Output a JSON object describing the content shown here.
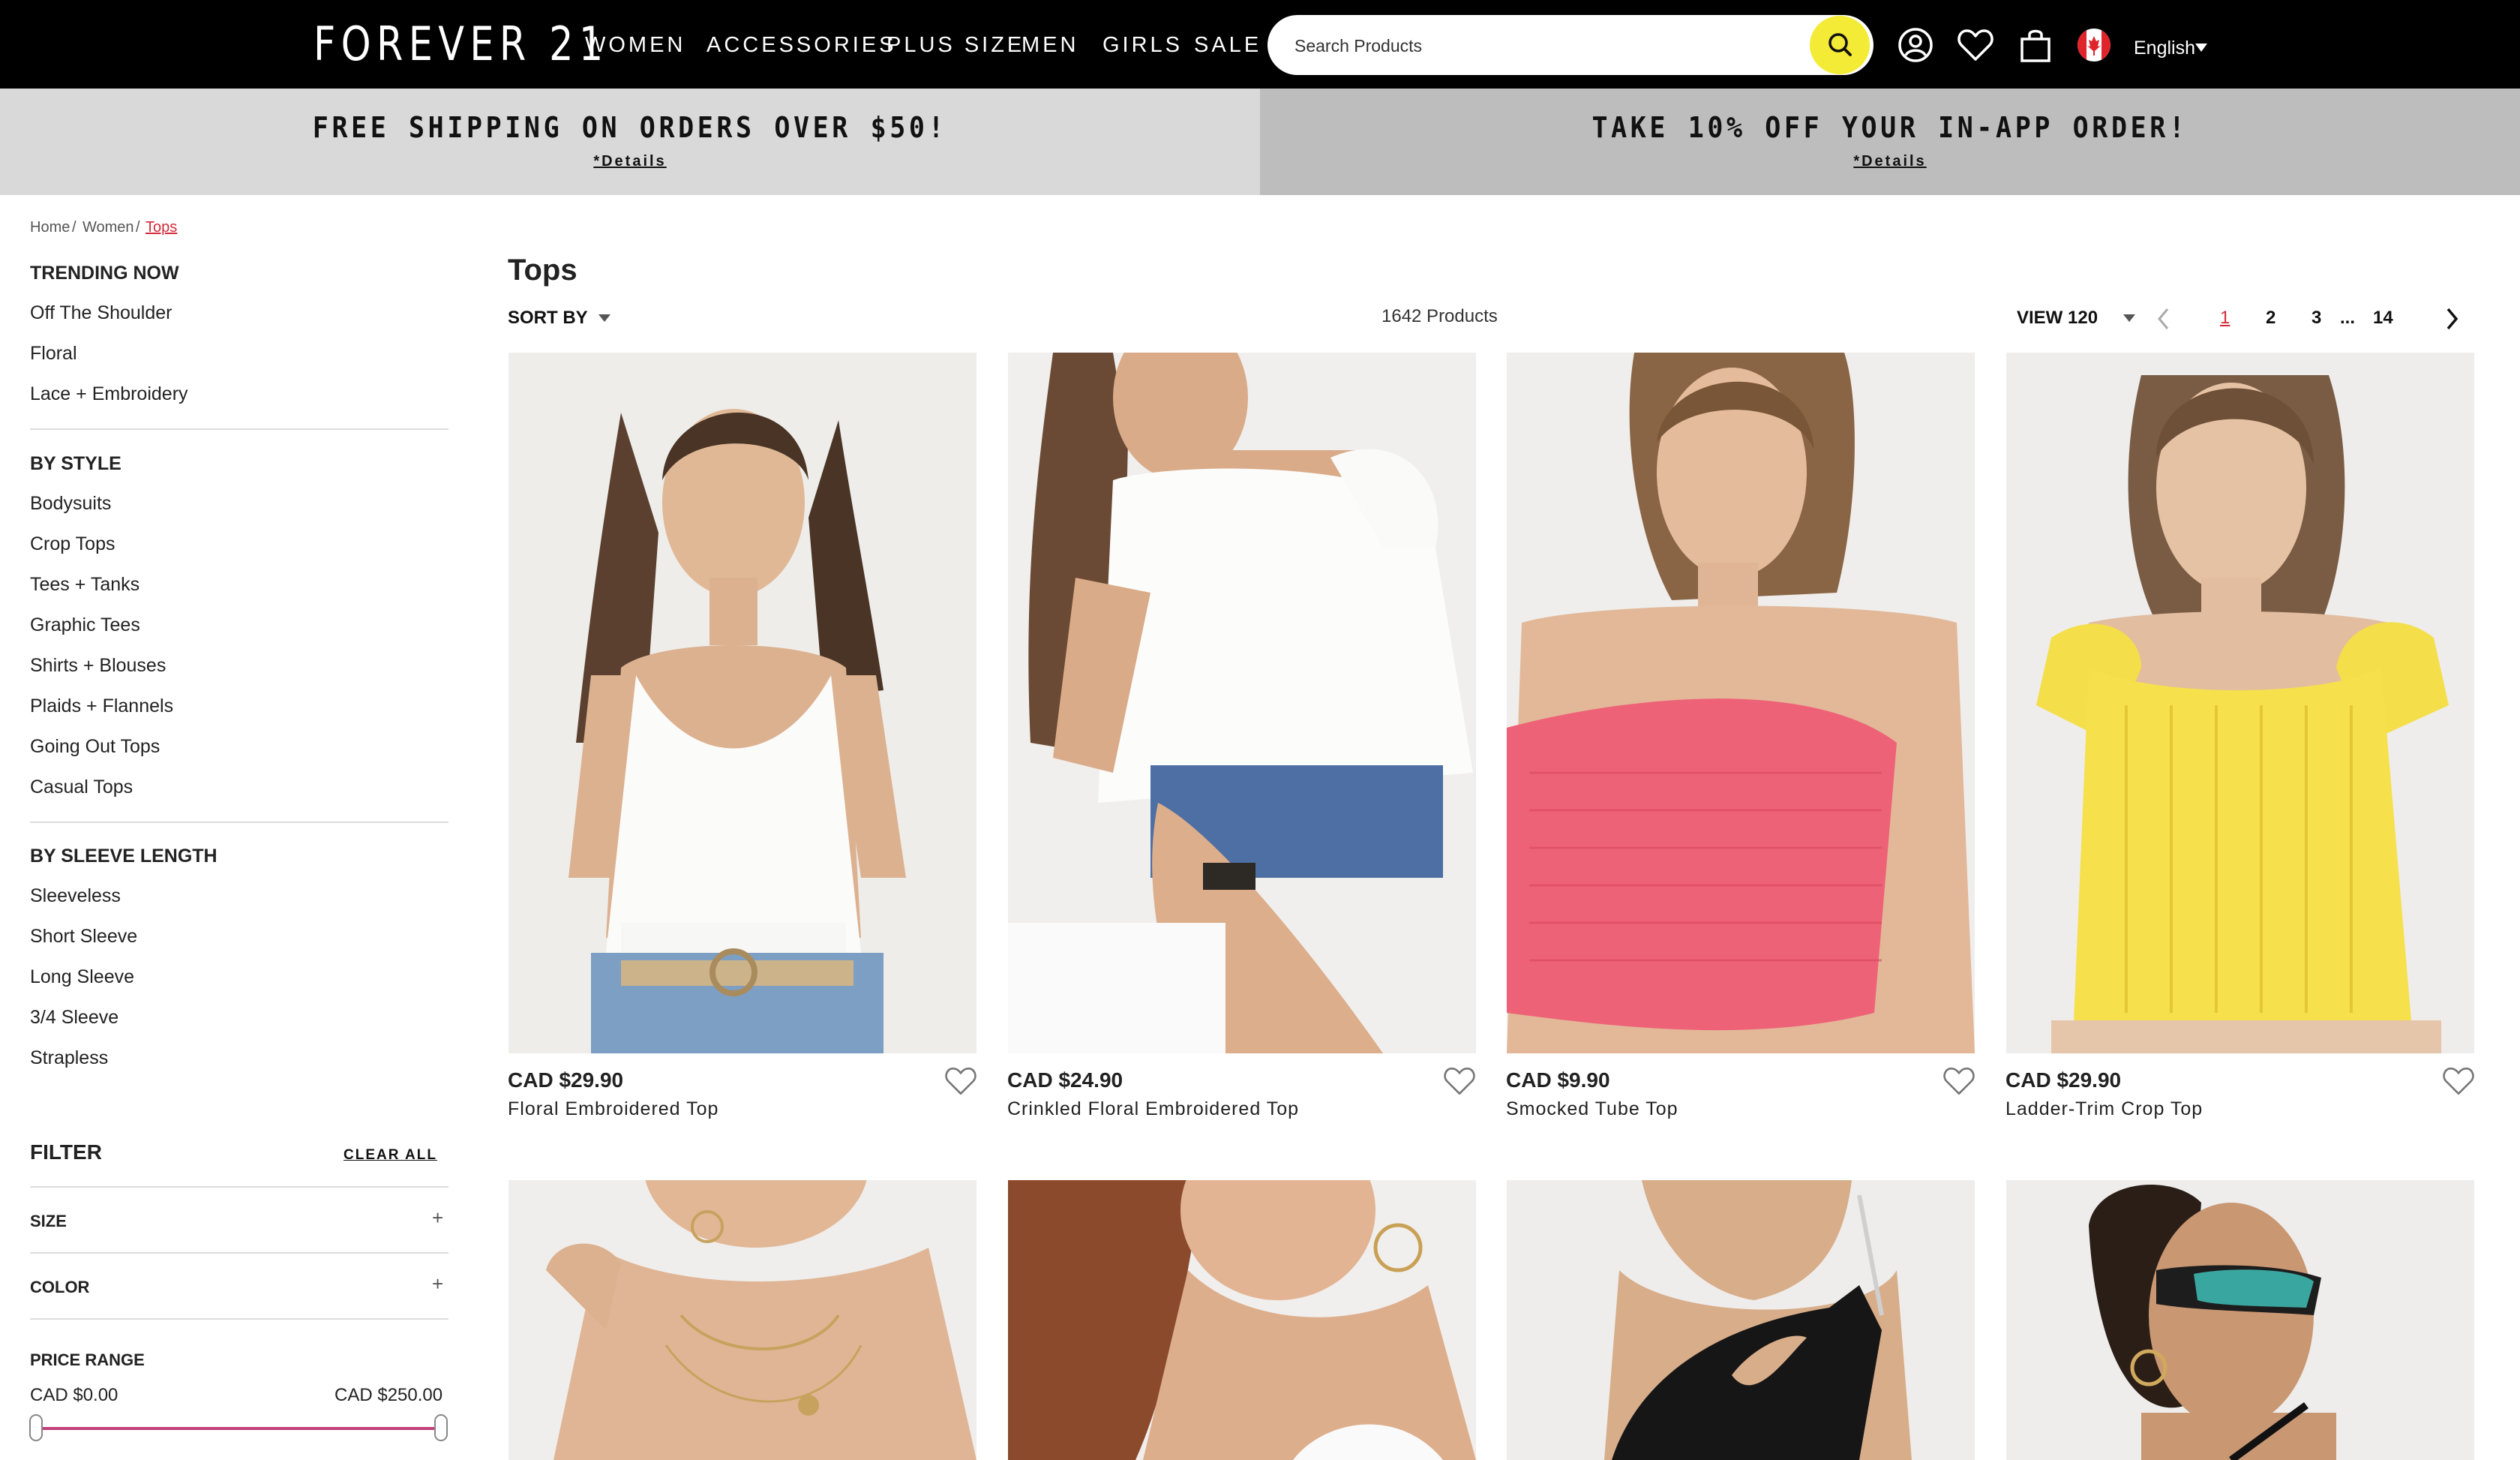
{
  "nav": {
    "logo": "FOREVER 21",
    "links": [
      "WOMEN",
      "ACCESSORIES",
      "PLUS SIZE",
      "MEN",
      "GIRLS",
      "SALE"
    ],
    "search_placeholder": "Search Products",
    "language": "English",
    "accent_color": "#f4eb37"
  },
  "promos": [
    {
      "title": "FREE SHIPPING ON ORDERS OVER $50!",
      "link": "*Details"
    },
    {
      "title": "TAKE 10% OFF YOUR IN-APP ORDER!",
      "link": "*Details"
    }
  ],
  "breadcrumb": [
    "Home",
    "Women",
    "Tops"
  ],
  "sidebar": {
    "trending": {
      "heading": "TRENDING NOW",
      "items": [
        "Off The Shoulder",
        "Floral",
        "Lace + Embroidery"
      ]
    },
    "style": {
      "heading": "BY STYLE",
      "items": [
        "Bodysuits",
        "Crop Tops",
        "Tees + Tanks",
        "Graphic Tees",
        "Shirts + Blouses",
        "Plaids + Flannels",
        "Going Out Tops",
        "Casual Tops"
      ]
    },
    "sleeve": {
      "heading": "BY SLEEVE LENGTH",
      "items": [
        "Sleeveless",
        "Short Sleeve",
        "Long Sleeve",
        "3/4 Sleeve",
        "Strapless"
      ]
    },
    "filter": {
      "heading": "FILTER",
      "clear": "CLEAR ALL",
      "size": "SIZE",
      "color": "COLOR",
      "toggle": "+"
    },
    "price": {
      "heading": "PRICE RANGE",
      "min": "CAD $0.00",
      "max": "CAD $250.00",
      "low_fraction": 0,
      "high_fraction": 1
    }
  },
  "main": {
    "title": "Tops",
    "sort_label": "SORT BY",
    "count": "1642 Products",
    "view_label": "VIEW 120",
    "pages": [
      "1",
      "2",
      "3",
      "...",
      "14"
    ],
    "current_page": "1"
  },
  "products": [
    {
      "price": "CAD $29.90",
      "name": "Floral Embroidered Top"
    },
    {
      "price": "CAD $24.90",
      "name": "Crinkled Floral Embroidered Top"
    },
    {
      "price": "CAD $9.90",
      "name": "Smocked Tube Top"
    },
    {
      "price": "CAD $29.90",
      "name": "Ladder-Trim Crop Top"
    }
  ]
}
